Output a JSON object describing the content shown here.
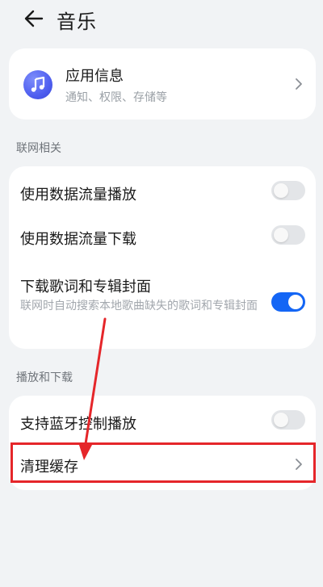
{
  "header": {
    "title": "音乐",
    "back_icon": "arrow-left-icon"
  },
  "app_info": {
    "title": "应用信息",
    "subtitle": "通知、权限、存储等",
    "icon": "music-note-icon",
    "icon_color": "#4f5ff0"
  },
  "network": {
    "label": "联网相关",
    "items": [
      {
        "label": "使用数据流量播放",
        "toggle": false
      },
      {
        "label": "使用数据流量下载",
        "toggle": false
      },
      {
        "label": "下载歌词和专辑封面",
        "sub": "联网时自动搜索本地歌曲缺失的歌词和专辑封面",
        "toggle": true
      }
    ]
  },
  "playback": {
    "label": "播放和下载",
    "items": [
      {
        "label": "支持蓝牙控制播放",
        "toggle": false
      },
      {
        "label": "清理缓存"
      }
    ]
  },
  "colors": {
    "background": "#f1f3f5",
    "card": "#ffffff",
    "toggle_on": "#1466f5",
    "annotation": "#e5262a"
  }
}
